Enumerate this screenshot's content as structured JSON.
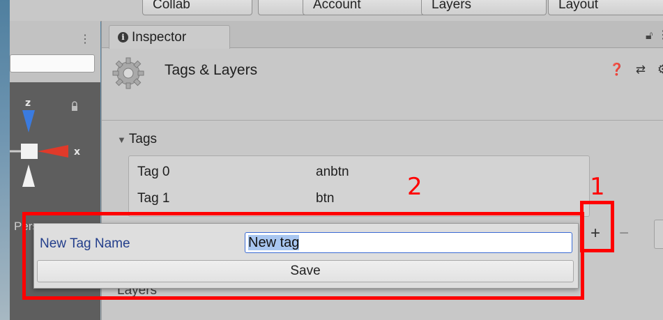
{
  "toolbar": {
    "buttons": [
      "Collab",
      "",
      "Account",
      "Layers",
      "Layout"
    ]
  },
  "scene": {
    "persp_label": "Persp",
    "axis_z": "z",
    "axis_x": "x"
  },
  "inspector": {
    "tab_label": "Inspector",
    "title": "Tags & Layers",
    "header_icons": "❓ ⇄ ⚙",
    "tags_section": "Tags",
    "tags": [
      {
        "name": "Tag 0",
        "value": "anbtn"
      },
      {
        "name": "Tag 1",
        "value": "btn"
      }
    ],
    "add_label": "+",
    "remove_label": "−",
    "layers_section": "Layers"
  },
  "popup": {
    "label": "New Tag Name",
    "input_value": "New tag",
    "save_label": "Save"
  },
  "annotations": {
    "one": "1",
    "two": "2",
    "color": "#ff0000"
  }
}
